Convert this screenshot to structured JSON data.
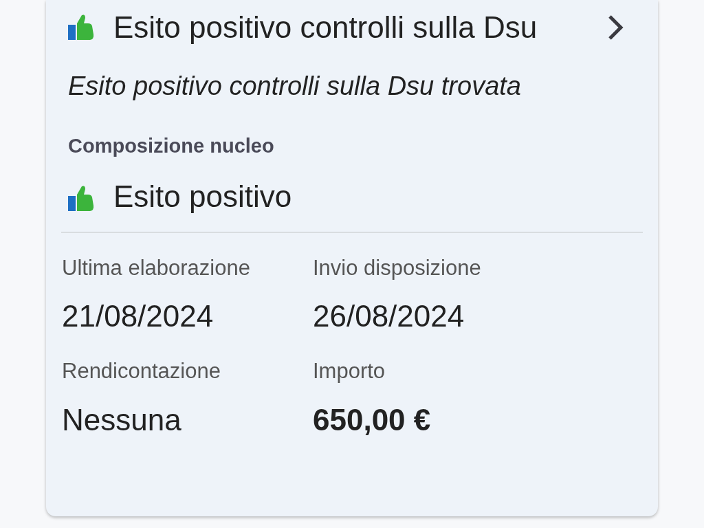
{
  "check": {
    "title": "Esito positivo controlli sulla Dsu",
    "description": "Esito positivo controlli sulla Dsu trovata",
    "positive": true
  },
  "section": {
    "heading": "Composizione nucleo",
    "result": "Esito positivo",
    "positive": true
  },
  "fields": [
    {
      "label": "Ultima elaborazione",
      "value": "21/08/2024",
      "bold": false
    },
    {
      "label": "Invio disposizione",
      "value": "26/08/2024",
      "bold": false
    },
    {
      "label": "Rendicontazione",
      "value": "Nessuna",
      "bold": false
    },
    {
      "label": "Importo",
      "value": "650,00 €",
      "bold": true
    }
  ]
}
